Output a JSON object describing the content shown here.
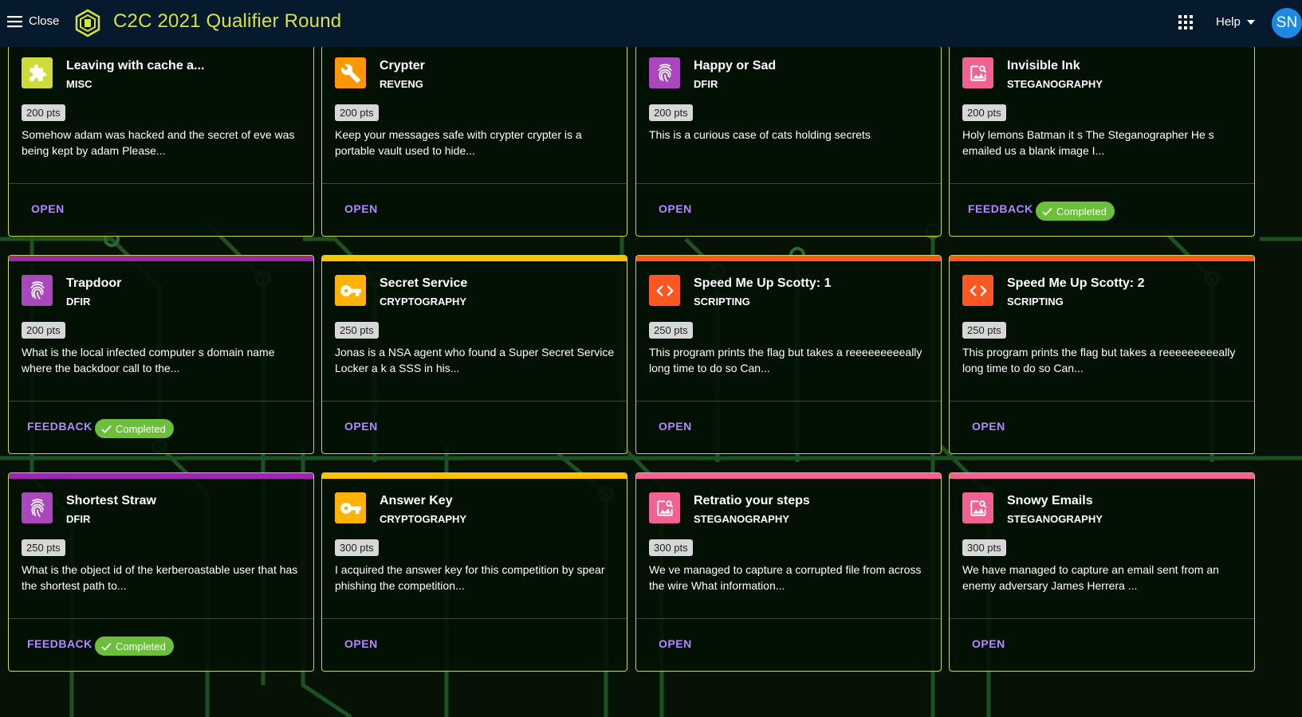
{
  "header": {
    "close_label": "Close",
    "title": "C2C 2021 Qualifier Round",
    "help_label": "Help",
    "avatar_initials": "SN",
    "title_color": "#d7e23a",
    "bar_color": "#061a2e"
  },
  "cards": [
    {
      "title": "Leaving with cache a...",
      "category": "MISC",
      "points": "200 pts",
      "description": "Somehow adam was hacked and the secret of eve was being kept by adam  Please...",
      "action": "OPEN",
      "completed": false,
      "icon": "puzzle-icon",
      "icon_color": "#cddc39",
      "accent": null
    },
    {
      "title": "Crypter",
      "category": "REVENG",
      "points": "200 pts",
      "description": "Keep your messages safe with crypter  crypter is a portable vault used to hide...",
      "action": "OPEN",
      "completed": false,
      "icon": "wrench-icon",
      "icon_color": "#ff9800",
      "accent": null
    },
    {
      "title": "Happy or Sad",
      "category": "DFIR",
      "points": "200 pts",
      "description": "This is a curious case of cats holding secrets",
      "action": "OPEN",
      "completed": false,
      "icon": "fingerprint-icon",
      "icon_color": "#ab47bc",
      "accent": null
    },
    {
      "title": "Invisible Ink",
      "category": "STEGANOGRAPHY",
      "points": "200 pts",
      "description": "Holy lemons  Batman  it s The Steganographer  He s emailed us a blank image   I...",
      "action": "FEEDBACK",
      "completed": true,
      "completed_label": "Completed",
      "icon": "image-search-icon",
      "icon_color": "#f06292",
      "accent": null
    },
    {
      "title": "Trapdoor",
      "category": "DFIR",
      "points": "200 pts",
      "description": "What is the local infected computer s domain name where the backdoor call to the...",
      "action": "FEEDBACK",
      "completed": true,
      "completed_label": "Completed",
      "icon": "fingerprint-icon",
      "icon_color": "#ab47bc",
      "accent": "#9c27b0"
    },
    {
      "title": "Secret Service",
      "category": "CRYPTOGRAPHY",
      "points": "250 pts",
      "description": "Jonas is a NSA agent who found a Super Secret Service Locker a k a SSS in his...",
      "action": "OPEN",
      "completed": false,
      "icon": "key-icon",
      "icon_color": "#ffb300",
      "accent": "#ffc107"
    },
    {
      "title": "Speed Me Up Scotty: 1",
      "category": "SCRIPTING",
      "points": "250 pts",
      "description": "This program prints the flag  but takes a reeeeeeeeeally long time to do so  Can...",
      "action": "OPEN",
      "completed": false,
      "icon": "code-icon",
      "icon_color": "#ff5722",
      "accent": "#ff5722"
    },
    {
      "title": "Speed Me Up Scotty: 2",
      "category": "SCRIPTING",
      "points": "250 pts",
      "description": "This program prints the flag  but takes a reeeeeeeeeally long time to do so  Can...",
      "action": "OPEN",
      "completed": false,
      "icon": "code-icon",
      "icon_color": "#ff5722",
      "accent": "#ff5722"
    },
    {
      "title": "Shortest Straw",
      "category": "DFIR",
      "points": "250 pts",
      "description": "What is the object id of the kerberoastable user that has the shortest path to...",
      "action": "FEEDBACK",
      "completed": true,
      "completed_label": "Completed",
      "icon": "fingerprint-icon",
      "icon_color": "#ab47bc",
      "accent": "#9c27b0"
    },
    {
      "title": "Answer Key",
      "category": "CRYPTOGRAPHY",
      "points": "300 pts",
      "description": "I acquired the answer key for this competition by spear phishing the competition...",
      "action": "OPEN",
      "completed": false,
      "icon": "key-icon",
      "icon_color": "#ffb300",
      "accent": "#ffc107"
    },
    {
      "title": "Retratio your steps",
      "category": "STEGANOGRAPHY",
      "points": "300 pts",
      "description": "We ve managed to capture a corrupted file from across the wire  What information...",
      "action": "OPEN",
      "completed": false,
      "icon": "image-search-icon",
      "icon_color": "#f06292",
      "accent": "#f06292"
    },
    {
      "title": "Snowy Emails",
      "category": "STEGANOGRAPHY",
      "points": "300 pts",
      "description": "We have managed to capture an email sent from an enemy adversary  James Herrera ...",
      "action": "OPEN",
      "completed": false,
      "icon": "image-search-icon",
      "icon_color": "#f06292",
      "accent": "#f06292"
    }
  ]
}
